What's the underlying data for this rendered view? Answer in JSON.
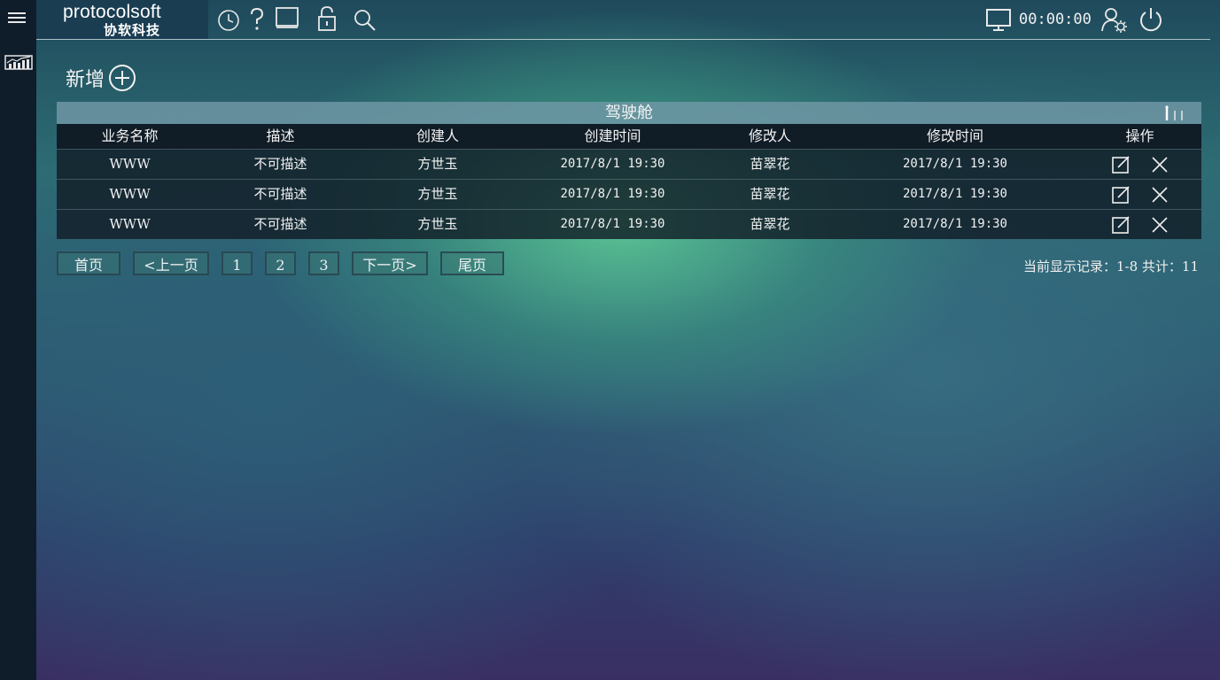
{
  "topbar": {
    "logo_text": "protocolsoft",
    "logo_subtitle": "协软科技",
    "clock": "00:00:00"
  },
  "sidebar": {
    "icons": [
      "menu-icon",
      "chart-icon"
    ]
  },
  "main": {
    "add_label": "新增",
    "table": {
      "title": "驾驶舱",
      "columns": [
        "业务名称",
        "描述",
        "创建人",
        "创建时间",
        "修改人",
        "修改时间",
        "操作"
      ],
      "rows": [
        [
          "WWW",
          "不可描述",
          "方世玉",
          "2017/8/1 19:30",
          "苗翠花",
          "2017/8/1 19:30"
        ],
        [
          "WWW",
          "不可描述",
          "方世玉",
          "2017/8/1 19:30",
          "苗翠花",
          "2017/8/1 19:30"
        ],
        [
          "WWW",
          "不可描述",
          "方世玉",
          "2017/8/1 19:30",
          "苗翠花",
          "2017/8/1 19:30"
        ]
      ]
    },
    "pager": {
      "first": "首页",
      "prev": "<上一页",
      "pages": [
        "1",
        "2",
        "3"
      ],
      "next": "下一页>",
      "last": "尾页"
    },
    "records": "当前显示记录：1-8  共计：11"
  },
  "colors": {
    "sidebar": "#0f1d2b",
    "logo_bg": "#1a3d52",
    "table_row_bg": "#101a24",
    "title_bar": "#6e96a5"
  }
}
